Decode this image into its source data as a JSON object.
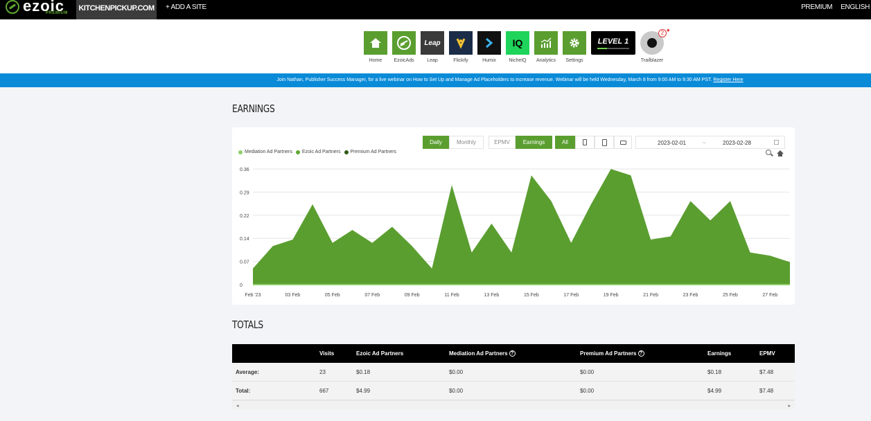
{
  "topbar": {
    "logo": "ezoic",
    "logo_sub": "PREMIUM",
    "site": "KITCHENPICKUP.COM",
    "add_site": "+ ADD A SITE",
    "right": [
      "PREMIUM",
      "ENGLISH"
    ]
  },
  "apps": [
    {
      "label": "Home",
      "icon": "house-icon",
      "color": "#5a9e30"
    },
    {
      "label": "EzoicAds",
      "icon": "ezoic-logo-icon",
      "color": "#5a9e30"
    },
    {
      "label": "Leap",
      "icon": "leap-logo-icon",
      "color": "#3a3a3a",
      "text": "Leap"
    },
    {
      "label": "Flickify",
      "icon": "flickify-logo-icon",
      "color": "#1a2c48"
    },
    {
      "label": "Humix",
      "icon": "humix-logo-icon",
      "color": "#111111"
    },
    {
      "label": "NicheIQ",
      "icon": "nicheiq-logo-icon",
      "color": "#1fd45a",
      "text": "IQ"
    },
    {
      "label": "Analytics",
      "icon": "analytics-chart-icon",
      "color": "#5a9e30"
    },
    {
      "label": "Settings",
      "icon": "gear-icon",
      "color": "#5a9e30"
    }
  ],
  "level": {
    "text": "LEVEL 1",
    "progress_fraction": 0.3
  },
  "trailblazer": {
    "label": "Trailblazer",
    "badge": "2"
  },
  "banner": {
    "text": "Join Nathan, Publisher Success Manager, for a live webinar on How to Set Up and Manage Ad Placeholders to increase revenue. Webinar will be held Wednesday, March 8 from 9:00 AM to 9:30 AM PST.",
    "link": "Register Here"
  },
  "earnings_heading": "EARNINGS",
  "controls": {
    "daily": "Daily",
    "monthly": "Monthly",
    "epmv": "EPMV",
    "earnings": "Earnings",
    "all": "All",
    "date_from": "2023-02-01",
    "date_sep": "~",
    "date_to": "2023-02-28"
  },
  "colors": {
    "mediation": "#8fce6a",
    "ezoic": "#5fa832",
    "premium": "#2f5a17",
    "area": "#5a9e30"
  },
  "chart_data": {
    "type": "area",
    "legend": [
      "Mediation Ad Partners",
      "Ezoic Ad Partners",
      "Premium Ad Partners"
    ],
    "y_ticks": [
      "0.36",
      "0.29",
      "0.22",
      "0.14",
      "0.07",
      "0"
    ],
    "x_ticks": [
      "Feb '23",
      "03 Feb",
      "05 Feb",
      "07 Feb",
      "09 Feb",
      "11 Feb",
      "13 Feb",
      "15 Feb",
      "17 Feb",
      "19 Feb",
      "21 Feb",
      "23 Feb",
      "25 Feb",
      "27 Feb"
    ],
    "ylim": [
      0,
      0.36
    ],
    "series": [
      {
        "name": "Ezoic Ad Partners",
        "values": [
          0.05,
          0.12,
          0.14,
          0.25,
          0.13,
          0.17,
          0.13,
          0.18,
          0.12,
          0.05,
          0.31,
          0.1,
          0.19,
          0.1,
          0.34,
          0.26,
          0.13,
          0.25,
          0.36,
          0.34,
          0.14,
          0.15,
          0.26,
          0.2,
          0.26,
          0.1,
          0.09,
          0.07
        ]
      }
    ]
  },
  "totals_heading": "TOTALS",
  "table": {
    "headers": [
      "Visits",
      "Ezoic Ad Partners",
      "Mediation Ad Partners",
      "Premium Ad Partners",
      "Earnings",
      "EPMV"
    ],
    "help": "?",
    "rows": [
      {
        "label": "Average:",
        "values": [
          "23",
          "$0.18",
          "$0.00",
          "$0.00",
          "$0.18",
          "$7.48"
        ]
      },
      {
        "label": "Total:",
        "values": [
          "667",
          "$4.99",
          "$0.00",
          "$0.00",
          "$4.99",
          "$7.48"
        ]
      }
    ],
    "scroll_left": "◂",
    "scroll_right": "▸"
  }
}
